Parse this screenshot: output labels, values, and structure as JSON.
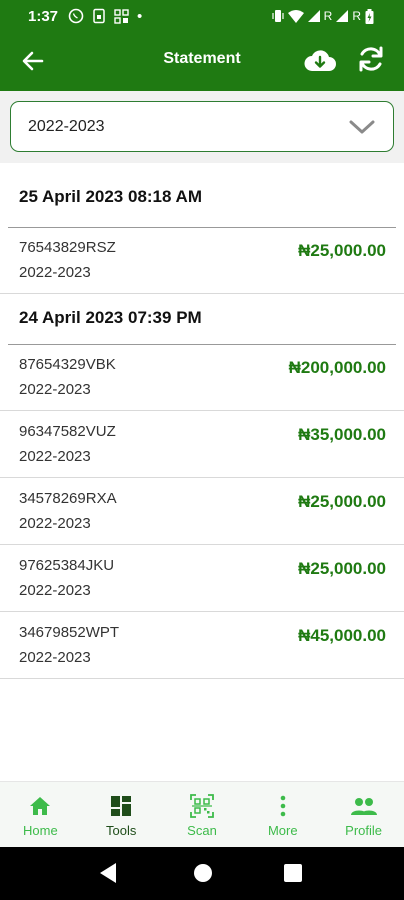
{
  "status_bar": {
    "time": "1:37",
    "dot": "•",
    "carrier_label": "R"
  },
  "appbar": {
    "title": "Statement"
  },
  "filter": {
    "selected": "2022-2023"
  },
  "groups": [
    {
      "date": "25 April 2023 08:18 AM",
      "items": [
        {
          "ref": "76543829RSZ",
          "year": "2022-2023",
          "amount": "₦25,000.00"
        }
      ]
    },
    {
      "date": "24 April 2023 07:39 PM",
      "items": [
        {
          "ref": "87654329VBK",
          "year": "2022-2023",
          "amount": "₦200,000.00"
        },
        {
          "ref": "96347582VUZ",
          "year": "2022-2023",
          "amount": "₦35,000.00"
        },
        {
          "ref": "34578269RXA",
          "year": "2022-2023",
          "amount": "₦25,000.00"
        },
        {
          "ref": "97625384JKU",
          "year": "2022-2023",
          "amount": "₦25,000.00"
        },
        {
          "ref": "34679852WPT",
          "year": "2022-2023",
          "amount": "₦45,000.00"
        }
      ]
    }
  ],
  "bottom_nav": [
    {
      "label": "Home",
      "icon": "home-icon",
      "color": "#3dbb4a"
    },
    {
      "label": "Tools",
      "icon": "grid-icon",
      "color": "#1f4d1a"
    },
    {
      "label": "Scan",
      "icon": "qr-scan-icon",
      "color": "#3dbb4a"
    },
    {
      "label": "More",
      "icon": "more-vertical-icon",
      "color": "#3dbb4a"
    },
    {
      "label": "Profile",
      "icon": "people-icon",
      "color": "#3dbb4a"
    }
  ],
  "colors": {
    "brand_green": "#1f7a12",
    "amount_green": "#1f7a12",
    "accent_green": "#3dbb4a"
  }
}
